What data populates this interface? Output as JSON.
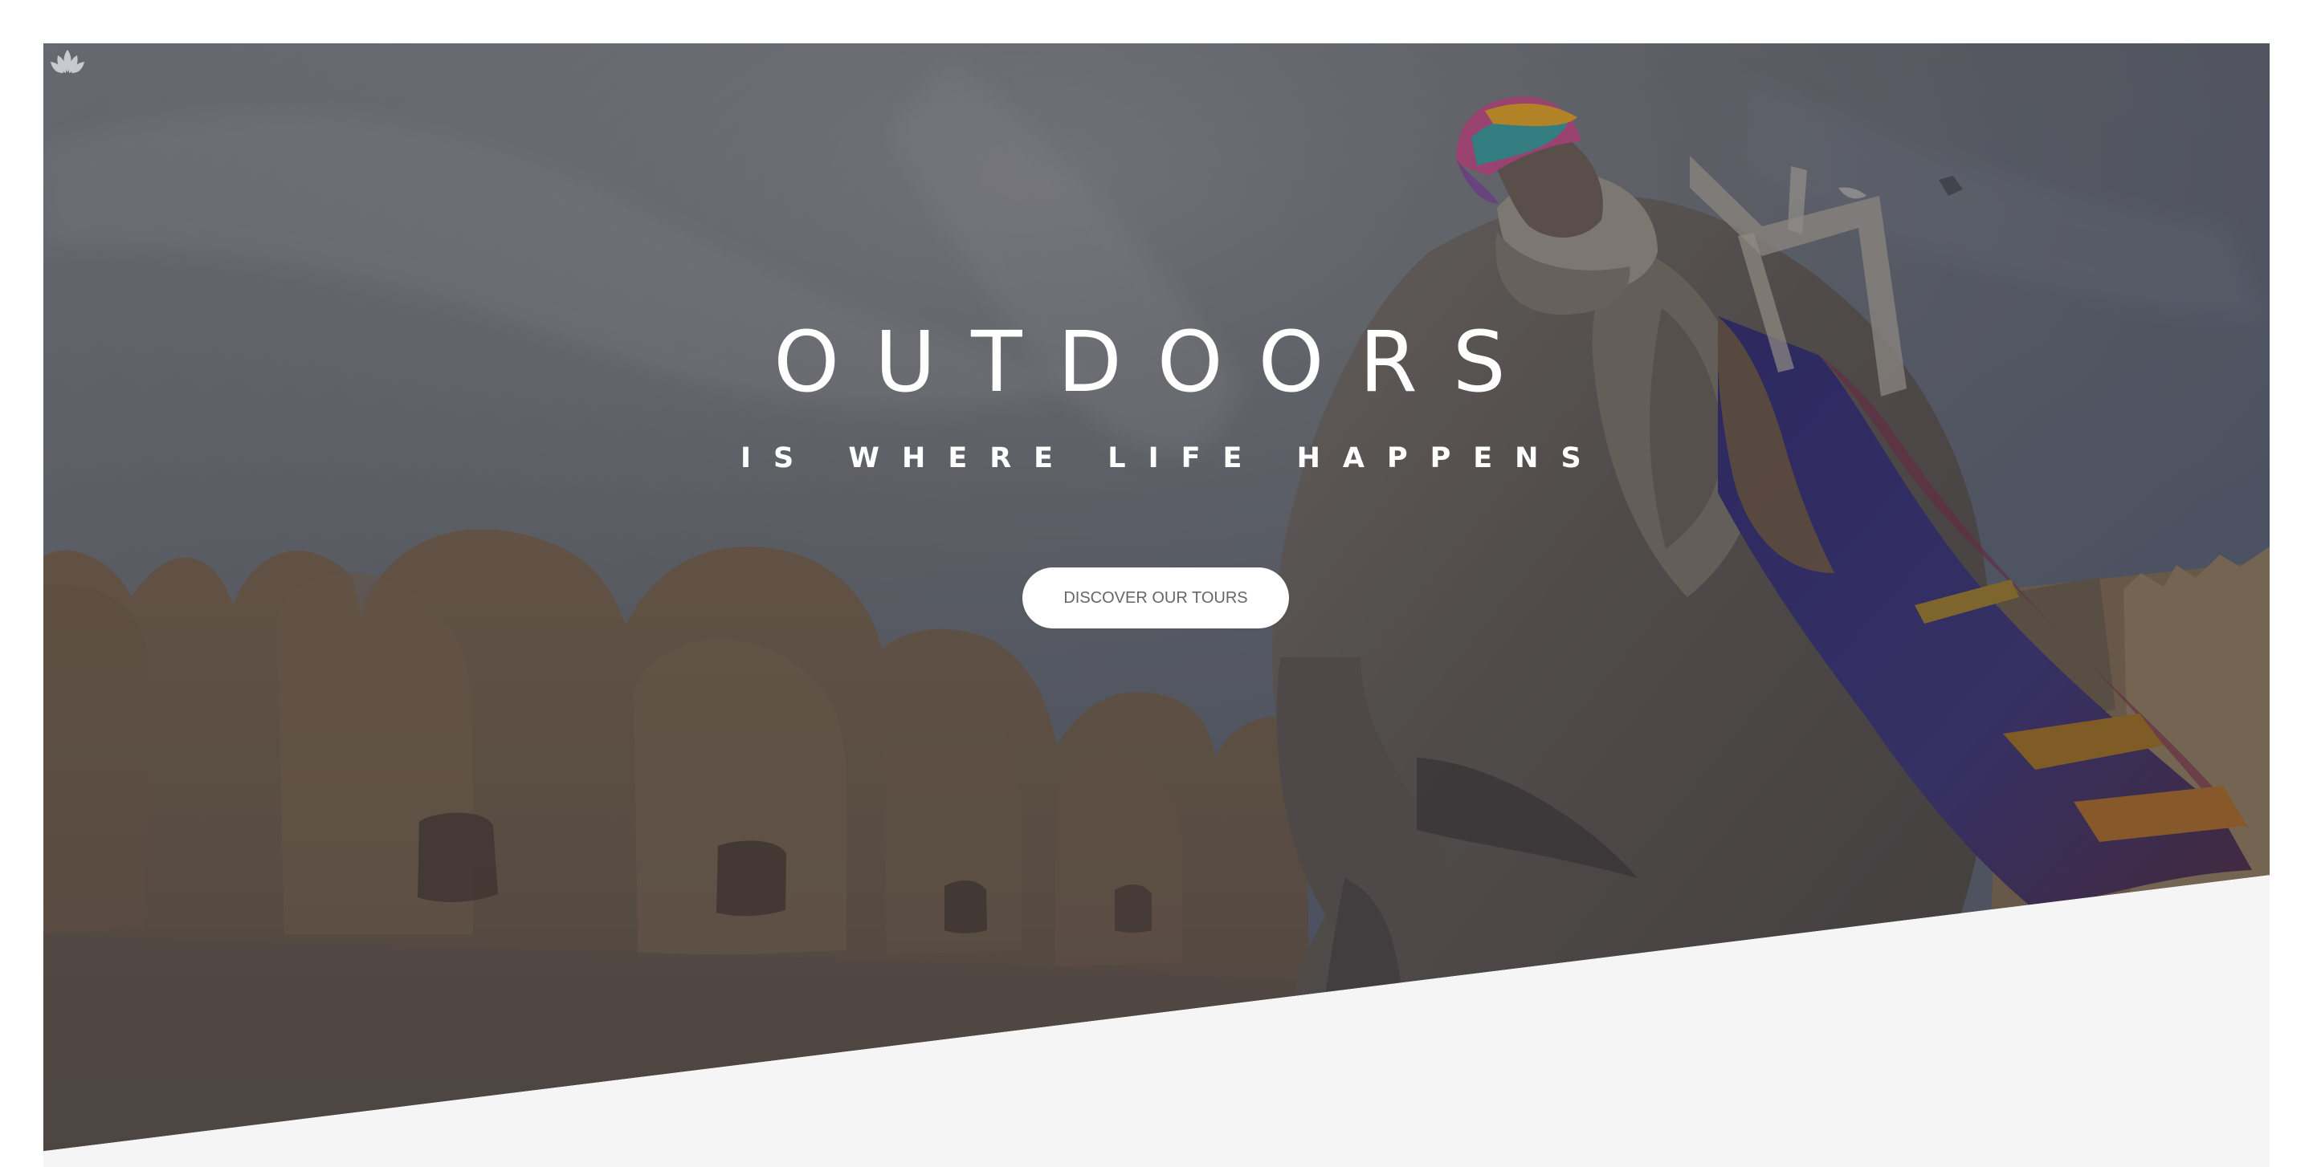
{
  "hero": {
    "title": "OUTDOORS",
    "subtitle": "IS WHERE LIFE HAPPENS",
    "cta_label": "DISCOVER OUR TOURS"
  },
  "icons": {
    "logo": "lotus-logo-icon"
  },
  "colors": {
    "background": "#ffffff",
    "lower_section": "#f5f5f5",
    "hero_text": "#ffffff",
    "button_background": "#ffffff",
    "button_text": "#65666b"
  }
}
